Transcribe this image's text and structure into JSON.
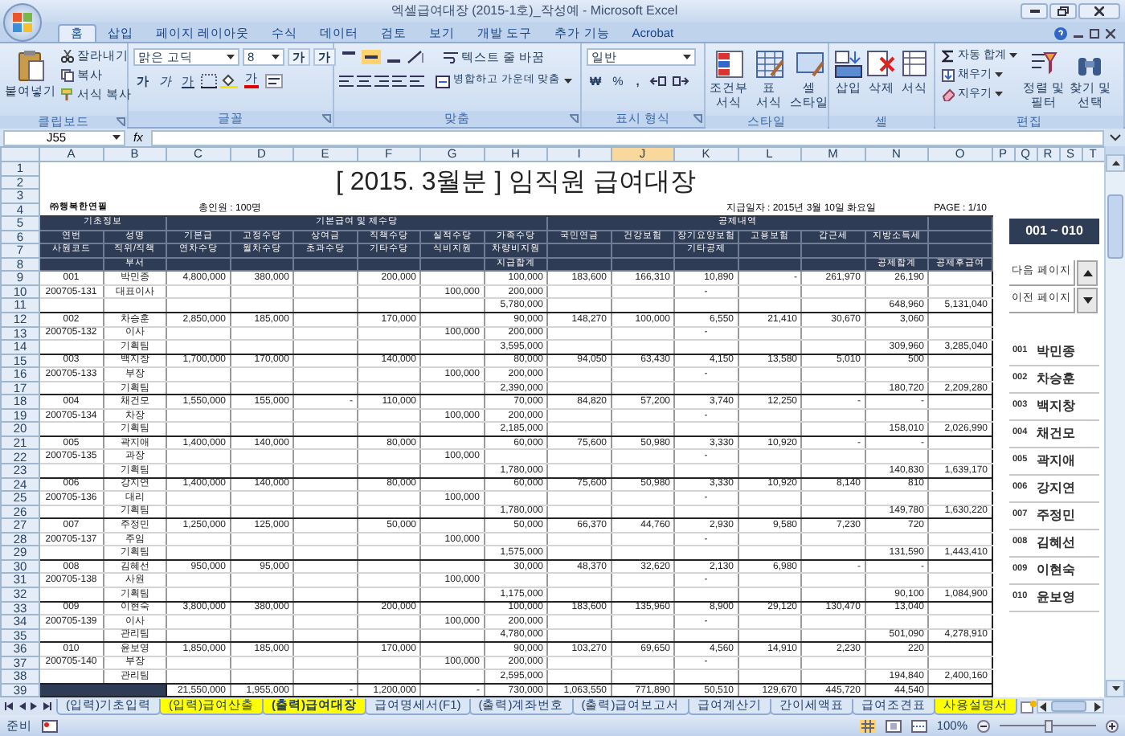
{
  "window": {
    "title": "엑셀급여대장 (2015-1호)_작성예 - Microsoft Excel"
  },
  "ribbon": {
    "tabs": [
      {
        "label": "홈",
        "selected": true
      },
      {
        "label": "삽입",
        "selected": false
      },
      {
        "label": "페이지 레이아웃",
        "selected": false
      },
      {
        "label": "수식",
        "selected": false
      },
      {
        "label": "데이터",
        "selected": false
      },
      {
        "label": "검토",
        "selected": false
      },
      {
        "label": "보기",
        "selected": false
      },
      {
        "label": "개발 도구",
        "selected": false
      },
      {
        "label": "추가 기능",
        "selected": false
      },
      {
        "label": "Acrobat",
        "selected": false
      }
    ],
    "groups": [
      {
        "kind": "clipboard",
        "label": "클립보드",
        "paste": "붙여넣기",
        "commands": [
          "잘라내기",
          "복사",
          "서식 복사"
        ]
      },
      {
        "kind": "font",
        "label": "글꼴",
        "font": "맑은 고딕",
        "size": "8",
        "grow": "가",
        "shrink": "가",
        "bold": "가",
        "italic": "가",
        "underline": "가",
        "font_color": "가"
      },
      {
        "kind": "alignment",
        "label": "맞춤",
        "wrap": "텍스트 줄 바꿈",
        "merge": "병합하고 가운데 맞춤"
      },
      {
        "kind": "number",
        "label": "표시 형식",
        "format": "일반",
        "currency": "₩",
        "percent": "%",
        "comma": ","
      },
      {
        "kind": "big",
        "label": "스타일",
        "commands": [
          "조건부 서식",
          "표 서식",
          "셀 스타일"
        ]
      },
      {
        "kind": "big",
        "label": "셀",
        "commands": [
          "삽입",
          "삭제",
          "서식"
        ]
      },
      {
        "kind": "editing",
        "label": "편집",
        "commands": [
          "자동 합계",
          "채우기",
          "지우기"
        ],
        "big_commands": [
          "정렬 및 필터",
          "찾기 및 선택"
        ]
      }
    ]
  },
  "formula_bar": {
    "name_box": "J55",
    "fx": "fx"
  },
  "sheet": {
    "columns": [
      {
        "label": "A",
        "selected": false
      },
      {
        "label": "B",
        "selected": false
      },
      {
        "label": "C",
        "selected": false
      },
      {
        "label": "D",
        "selected": false
      },
      {
        "label": "E",
        "selected": false
      },
      {
        "label": "F",
        "selected": false
      },
      {
        "label": "G",
        "selected": false
      },
      {
        "label": "H",
        "selected": false
      },
      {
        "label": "I",
        "selected": false
      },
      {
        "label": "J",
        "selected": true
      },
      {
        "label": "K",
        "selected": false
      },
      {
        "label": "L",
        "selected": false
      },
      {
        "label": "M",
        "selected": false
      },
      {
        "label": "N",
        "selected": false
      },
      {
        "label": "O",
        "selected": false
      },
      {
        "label": "P",
        "selected": false
      },
      {
        "label": "Q",
        "selected": false
      },
      {
        "label": "R",
        "selected": false
      },
      {
        "label": "S",
        "selected": false
      },
      {
        "label": "T",
        "selected": false
      }
    ],
    "rows": [
      "1",
      "2",
      "3",
      "4",
      "5",
      "6",
      "7",
      "8",
      "9",
      "10",
      "11",
      "12",
      "13",
      "14",
      "15",
      "16",
      "17",
      "18",
      "19",
      "20",
      "21",
      "22",
      "23",
      "24",
      "25",
      "26",
      "27",
      "28",
      "29",
      "30",
      "31",
      "32",
      "33",
      "34",
      "35",
      "36",
      "37",
      "38",
      "39"
    ],
    "title": "[ 2015. 3월분 ]  임직원 급여대장",
    "company": "㈜행복한연필",
    "headcount": "총인원 : 100명",
    "pay_date": "지급일자 : 2015년 3월 10일 화요일",
    "page": "PAGE : 1/10",
    "header_groups": [
      "기초정보",
      "기본급여 및 제수당",
      "공제내역"
    ],
    "header_rows": [
      {
        "A": "연번",
        "B": "성명",
        "C": "기본급",
        "D": "고정수당",
        "E": "상여금",
        "F": "직책수당",
        "G": "실적수당",
        "H": "가족수당",
        "I": "국민연금",
        "J": "건강보험",
        "K": "장기요양보험",
        "L": "고용보험",
        "M": "갑근세",
        "N": "지방소득세"
      },
      {
        "A": "사원코드",
        "B": "직위/직책",
        "C": "연차수당",
        "D": "월차수당",
        "E": "초과수당",
        "F": "기타수당",
        "G": "식비지원",
        "H": "차량비지원",
        "K": "기타공제"
      },
      {
        "B": "부서",
        "H": "지급합계",
        "N": "공제합계",
        "O": "공제후급여"
      }
    ],
    "employees": [
      {
        "row_1": {
          "A": "001",
          "B": "박민종",
          "C": "4,800,000",
          "D": "380,000",
          "F": "200,000",
          "H": "100,000",
          "I": "183,600",
          "J": "166,310",
          "K": "10,890",
          "L": "-",
          "M": "261,970",
          "N": "26,190"
        },
        "row_2": {
          "A": "200705-131",
          "B": "대표이사",
          "G": "100,000",
          "H": "200,000",
          "K": "-"
        },
        "row_3": {
          "H": "5,780,000",
          "N": "648,960",
          "O": "5,131,040"
        }
      },
      {
        "row_1": {
          "A": "002",
          "B": "차승훈",
          "C": "2,850,000",
          "D": "185,000",
          "F": "170,000",
          "H": "90,000",
          "I": "148,270",
          "J": "100,000",
          "K": "6,550",
          "L": "21,410",
          "M": "30,670",
          "N": "3,060"
        },
        "row_2": {
          "A": "200705-132",
          "B": "이사",
          "G": "100,000",
          "H": "200,000",
          "K": "-"
        },
        "row_3": {
          "B": "기획팀",
          "H": "3,595,000",
          "N": "309,960",
          "O": "3,285,040"
        }
      },
      {
        "row_1": {
          "A": "003",
          "B": "백지창",
          "C": "1,700,000",
          "D": "170,000",
          "F": "140,000",
          "H": "80,000",
          "I": "94,050",
          "J": "63,430",
          "K": "4,150",
          "L": "13,580",
          "M": "5,010",
          "N": "500"
        },
        "row_2": {
          "A": "200705-133",
          "B": "부장",
          "G": "100,000",
          "H": "200,000",
          "K": "-"
        },
        "row_3": {
          "B": "기획팀",
          "H": "2,390,000",
          "N": "180,720",
          "O": "2,209,280"
        }
      },
      {
        "row_1": {
          "A": "004",
          "B": "채건모",
          "C": "1,550,000",
          "D": "155,000",
          "E": "-",
          "F": "110,000",
          "H": "70,000",
          "I": "84,820",
          "J": "57,200",
          "K": "3,740",
          "L": "12,250",
          "M": "-",
          "N": "-"
        },
        "row_2": {
          "A": "200705-134",
          "B": "차장",
          "G": "100,000",
          "H": "200,000",
          "K": "-"
        },
        "row_3": {
          "B": "기획팀",
          "H": "2,185,000",
          "N": "158,010",
          "O": "2,026,990"
        }
      },
      {
        "row_1": {
          "A": "005",
          "B": "곽지애",
          "C": "1,400,000",
          "D": "140,000",
          "F": "80,000",
          "H": "60,000",
          "I": "75,600",
          "J": "50,980",
          "K": "3,330",
          "L": "10,920",
          "M": "-",
          "N": "-"
        },
        "row_2": {
          "A": "200705-135",
          "B": "과장",
          "G": "100,000",
          "K": "-"
        },
        "row_3": {
          "B": "기획팀",
          "H": "1,780,000",
          "N": "140,830",
          "O": "1,639,170"
        }
      },
      {
        "row_1": {
          "A": "006",
          "B": "강지연",
          "C": "1,400,000",
          "D": "140,000",
          "F": "80,000",
          "H": "60,000",
          "I": "75,600",
          "J": "50,980",
          "K": "3,330",
          "L": "10,920",
          "M": "8,140",
          "N": "810"
        },
        "row_2": {
          "A": "200705-136",
          "B": "대리",
          "G": "100,000",
          "K": "-"
        },
        "row_3": {
          "B": "기획팀",
          "H": "1,780,000",
          "N": "149,780",
          "O": "1,630,220"
        }
      },
      {
        "row_1": {
          "A": "007",
          "B": "주정민",
          "C": "1,250,000",
          "D": "125,000",
          "F": "50,000",
          "H": "50,000",
          "I": "66,370",
          "J": "44,760",
          "K": "2,930",
          "L": "9,580",
          "M": "7,230",
          "N": "720"
        },
        "row_2": {
          "A": "200705-137",
          "B": "주임",
          "G": "100,000",
          "K": "-"
        },
        "row_3": {
          "B": "기획팀",
          "H": "1,575,000",
          "N": "131,590",
          "O": "1,443,410"
        }
      },
      {
        "row_1": {
          "A": "008",
          "B": "김혜선",
          "C": "950,000",
          "D": "95,000",
          "H": "30,000",
          "I": "48,370",
          "J": "32,620",
          "K": "2,130",
          "L": "6,980",
          "M": "-",
          "N": "-"
        },
        "row_2": {
          "A": "200705-138",
          "B": "사원",
          "G": "100,000",
          "K": "-"
        },
        "row_3": {
          "B": "기획팀",
          "H": "1,175,000",
          "N": "90,100",
          "O": "1,084,900"
        }
      },
      {
        "row_1": {
          "A": "009",
          "B": "이현숙",
          "C": "3,800,000",
          "D": "380,000",
          "F": "200,000",
          "H": "100,000",
          "I": "183,600",
          "J": "135,960",
          "K": "8,900",
          "L": "29,120",
          "M": "130,470",
          "N": "13,040"
        },
        "row_2": {
          "A": "200705-139",
          "B": "이사",
          "G": "100,000",
          "H": "200,000",
          "K": "-"
        },
        "row_3": {
          "B": "관리팀",
          "H": "4,780,000",
          "N": "501,090",
          "O": "4,278,910"
        }
      },
      {
        "row_1": {
          "A": "010",
          "B": "윤보영",
          "C": "1,850,000",
          "D": "185,000",
          "F": "170,000",
          "H": "90,000",
          "I": "103,270",
          "J": "69,650",
          "K": "4,560",
          "L": "14,910",
          "M": "2,230",
          "N": "220"
        },
        "row_2": {
          "A": "200705-140",
          "B": "부장",
          "G": "100,000",
          "H": "200,000",
          "K": "-"
        },
        "row_3": {
          "B": "관리팀",
          "H": "2,595,000",
          "N": "194,840",
          "O": "2,400,160"
        }
      }
    ],
    "totals": {
      "C": "21,550,000",
      "D": "1,955,000",
      "E": "-",
      "F": "1,200,000",
      "G": "-",
      "H": "730,000",
      "I": "1,063,550",
      "J": "771,890",
      "K": "50,510",
      "L": "129,670",
      "M": "445,720",
      "N": "44,540"
    }
  },
  "navigator": {
    "range": "001 ~ 010",
    "page_buttons": [
      "다음 페이지",
      "이전 페이지"
    ],
    "employees": [
      {
        "no": "001",
        "name": "박민종"
      },
      {
        "no": "002",
        "name": "차승훈"
      },
      {
        "no": "003",
        "name": "백지창"
      },
      {
        "no": "004",
        "name": "채건모"
      },
      {
        "no": "005",
        "name": "곽지애"
      },
      {
        "no": "006",
        "name": "강지연"
      },
      {
        "no": "007",
        "name": "주정민"
      },
      {
        "no": "008",
        "name": "김혜선"
      },
      {
        "no": "009",
        "name": "이현숙"
      },
      {
        "no": "010",
        "name": "윤보영"
      }
    ]
  },
  "sheet_tabs": [
    {
      "label": "(입력)기초입력",
      "selected": false
    },
    {
      "label": "(입력)급여산출",
      "selected": false,
      "color": "#ffff00"
    },
    {
      "label": "(출력)급여대장",
      "selected": true,
      "color": "#ffff00"
    },
    {
      "label": "급여명세서(F1)",
      "selected": false
    },
    {
      "label": "(출력)계좌번호",
      "selected": false
    },
    {
      "label": "(출력)급여보고서",
      "selected": false
    },
    {
      "label": "급여계산기",
      "selected": false
    },
    {
      "label": "간이세액표",
      "selected": false
    },
    {
      "label": "급여조견표",
      "selected": false
    },
    {
      "label": "사용설명서",
      "selected": false,
      "color": "#ffff00"
    }
  ],
  "status_bar": {
    "status": "준비",
    "zoom": "100%",
    "zoom_slider": {
      "level": 0.5
    }
  }
}
